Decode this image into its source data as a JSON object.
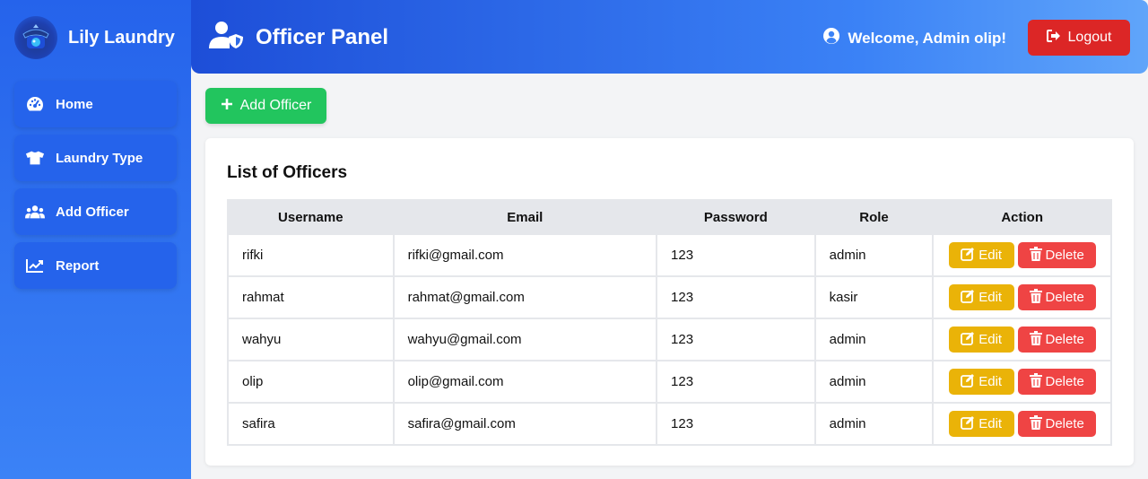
{
  "app": {
    "name": "Lily Laundry"
  },
  "sidebar": {
    "items": [
      {
        "label": "Home",
        "icon": "dashboard-icon"
      },
      {
        "label": "Laundry Type",
        "icon": "shirt-icon"
      },
      {
        "label": "Add Officer",
        "icon": "users-icon"
      },
      {
        "label": "Report",
        "icon": "chart-line-icon"
      }
    ]
  },
  "header": {
    "title": "Officer Panel",
    "welcome": "Welcome, Admin olip!",
    "logout_label": "Logout"
  },
  "toolbar": {
    "add_label": "Add Officer"
  },
  "table": {
    "title": "List of Officers",
    "columns": [
      "Username",
      "Email",
      "Password",
      "Role",
      "Action"
    ],
    "rows": [
      {
        "username": "rifki",
        "email": "rifki@gmail.com",
        "password": "123",
        "role": "admin"
      },
      {
        "username": "rahmat",
        "email": "rahmat@gmail.com",
        "password": "123",
        "role": "kasir"
      },
      {
        "username": "wahyu",
        "email": "wahyu@gmail.com",
        "password": "123",
        "role": "admin"
      },
      {
        "username": "olip",
        "email": "olip@gmail.com",
        "password": "123",
        "role": "admin"
      },
      {
        "username": "safira",
        "email": "safira@gmail.com",
        "password": "123",
        "role": "admin"
      }
    ],
    "edit_label": "Edit",
    "delete_label": "Delete"
  },
  "colors": {
    "primary": "#2563eb",
    "success": "#22c55e",
    "warning": "#eab308",
    "danger": "#ef4444",
    "logout": "#dc2626"
  }
}
